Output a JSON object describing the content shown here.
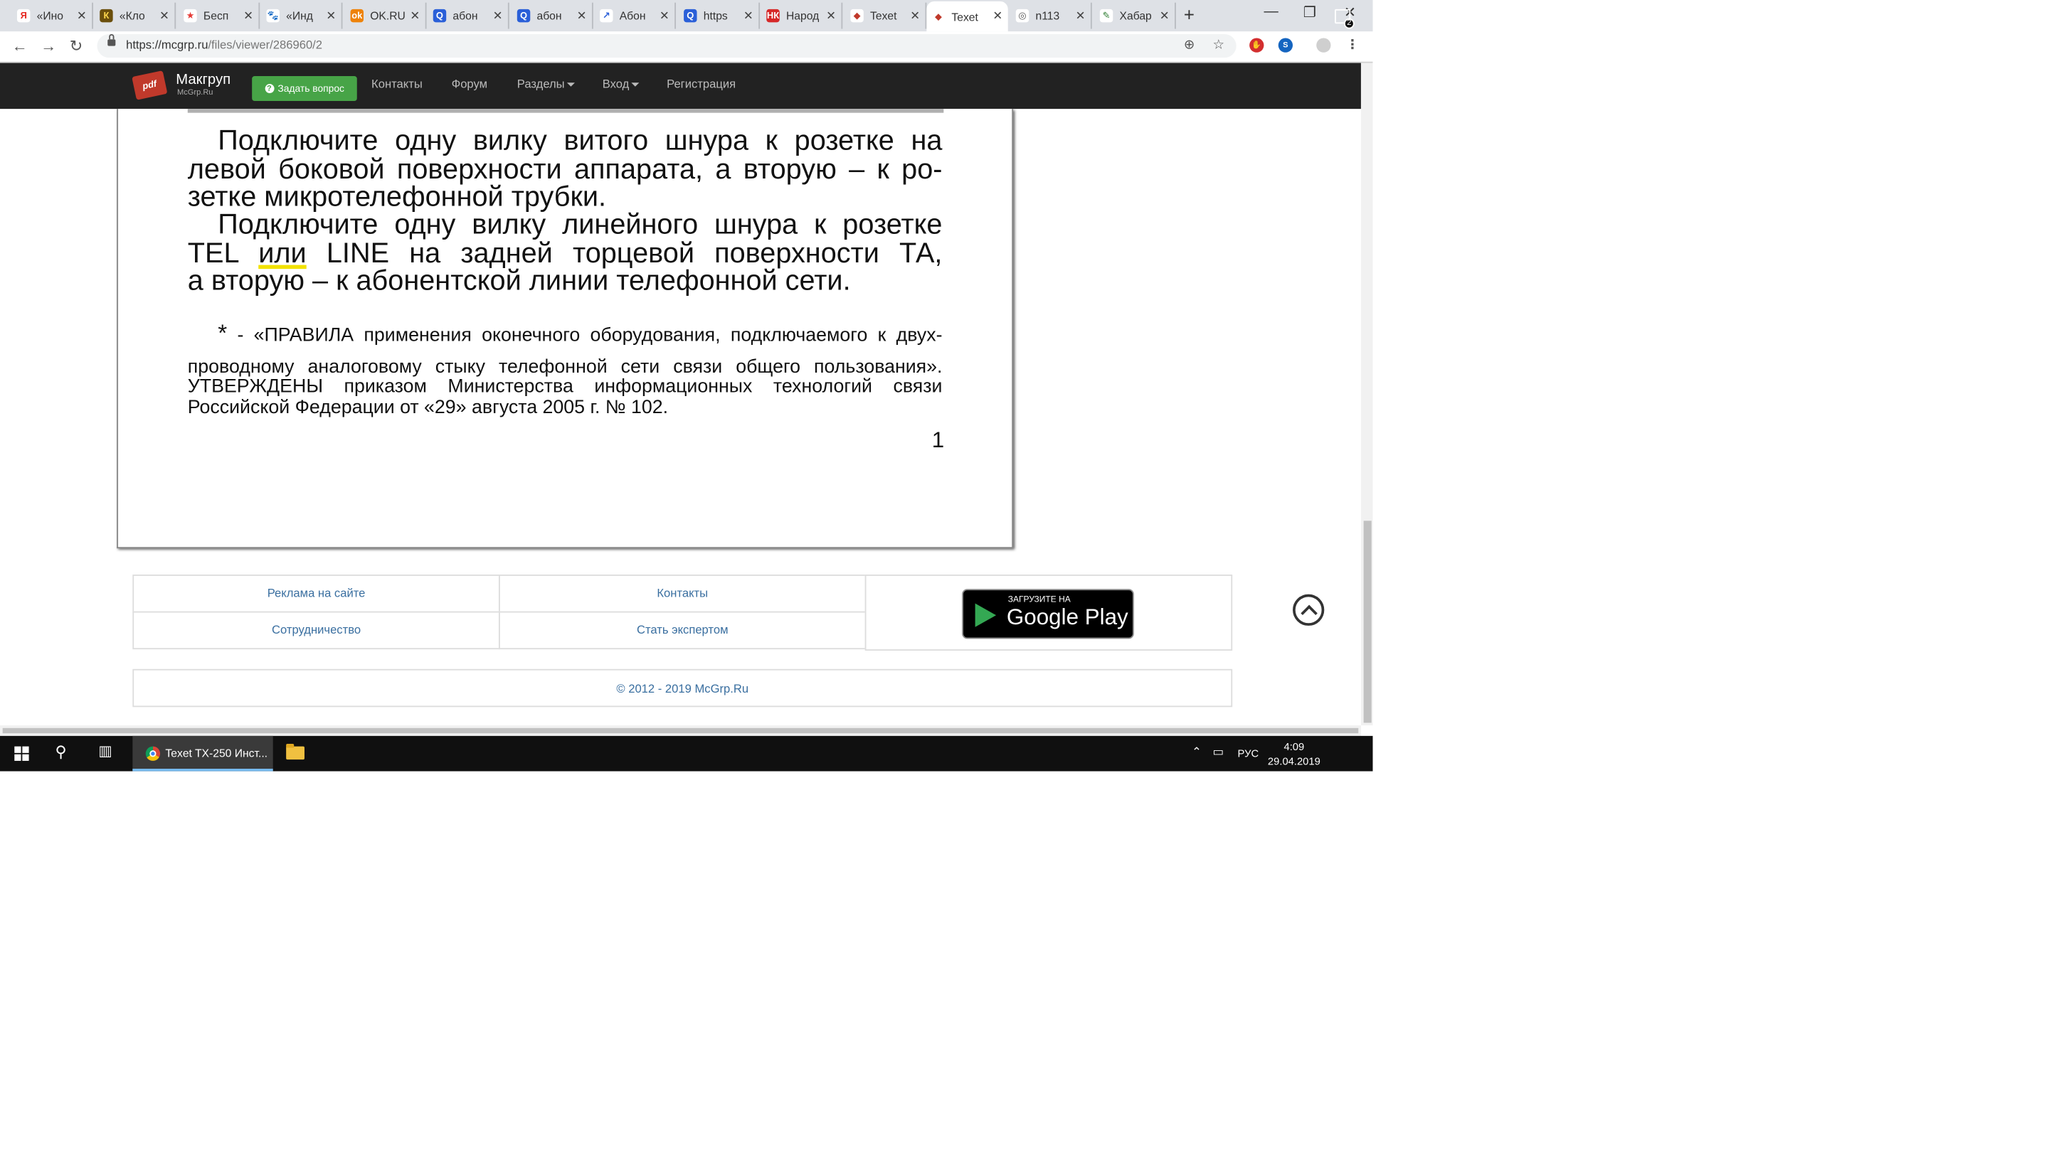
{
  "browser": {
    "tabs": [
      {
        "title": "«Ино",
        "fav_color": "#ffffff",
        "fav_glyph": "Я",
        "fav_text_color": "#e52620"
      },
      {
        "title": "«Кло",
        "fav_color": "#6b4f0c",
        "fav_glyph": "К",
        "fav_text_color": "#ffd84d"
      },
      {
        "title": "Бесп",
        "fav_color": "#ffffff",
        "fav_glyph": "★",
        "fav_text_color": "#e53935"
      },
      {
        "title": "«Инд",
        "fav_color": "#ffffff",
        "fav_glyph": "🐾",
        "fav_text_color": "#111111"
      },
      {
        "title": "OK.RU",
        "fav_color": "#ee8208",
        "fav_glyph": "ok",
        "fav_text_color": "#ffffff"
      },
      {
        "title": "абон",
        "fav_color": "#2a5fd8",
        "fav_glyph": "Q",
        "fav_text_color": "#ffffff"
      },
      {
        "title": "абон",
        "fav_color": "#2a5fd8",
        "fav_glyph": "Q",
        "fav_text_color": "#ffffff"
      },
      {
        "title": "Абон",
        "fav_color": "#ffffff",
        "fav_glyph": "↗",
        "fav_text_color": "#2a5fd8"
      },
      {
        "title": "https",
        "fav_color": "#2a5fd8",
        "fav_glyph": "Q",
        "fav_text_color": "#ffffff"
      },
      {
        "title": "Народ",
        "fav_color": "#d62828",
        "fav_glyph": "НК",
        "fav_text_color": "#ffffff"
      },
      {
        "title": "Texet",
        "fav_color": "#ffffff",
        "fav_glyph": "◆",
        "fav_text_color": "#c0392b"
      },
      {
        "title": "Texet",
        "fav_color": "#ffffff",
        "fav_glyph": "◆",
        "fav_text_color": "#c0392b",
        "active": true
      },
      {
        "title": "n113",
        "fav_color": "#ffffff",
        "fav_glyph": "◎",
        "fav_text_color": "#555555"
      },
      {
        "title": "Хабар",
        "fav_color": "#ffffff",
        "fav_glyph": "✎",
        "fav_text_color": "#2e7d32"
      }
    ],
    "new_tab": "+",
    "url_host": "https://mcgrp.ru",
    "url_path": "/files/viewer/286960/2"
  },
  "site": {
    "logo_badge": "pdf",
    "logo_name": "Макгруп",
    "logo_sub": "McGrp.Ru",
    "ask_button": "Задать вопрос",
    "nav": {
      "contacts": "Контакты",
      "forum": "Форум",
      "sections": "Разделы",
      "login": "Вход",
      "register": "Регистрация"
    }
  },
  "document": {
    "p1_lines": [
      "Подключите одну вилку витого шнура к розетке на",
      "левой боковой поверхности аппарата, а вторую – к ро-",
      "зетке микротелефонной трубки."
    ],
    "p2_l1": "Подключите одну вилку линейного шнура к розетке",
    "p2_l2_a": "TEL",
    "p2_l2_hl": "или",
    "p2_l2_b": "LINE на задней торцевой поверхности ТА,",
    "p2_l3": "а вторую – к абонентской линии телефонной сети.",
    "fn_star": "*",
    "fn_l1": " - «ПРАВИЛА применения оконечного оборудования, подключаемого к двух-",
    "fn_l2": "проводному аналоговому стыку телефонной сети связи общего пользования».",
    "fn_l3": "УТВЕРЖДЕНЫ приказом Министерства информационных технологий    связи",
    "fn_l4": "Российской Федерации от «29» августа  2005 г. №  102.",
    "page_number": "1"
  },
  "footer": {
    "ads": "Реклама на сайте",
    "contacts": "Контакты",
    "cooperation": "Сотрудничество",
    "expert": "Стать экспертом",
    "gplay_small": "ЗАГРУЗИТЕ НА",
    "gplay_big": "Google Play",
    "copyright": "© 2012 - 2019 McGrp.Ru"
  },
  "taskbar": {
    "app_label": "Texet TX-250 Инст...",
    "lang": "РУС",
    "time": "4:09",
    "date": "29.04.2019",
    "notif_count": "2"
  }
}
